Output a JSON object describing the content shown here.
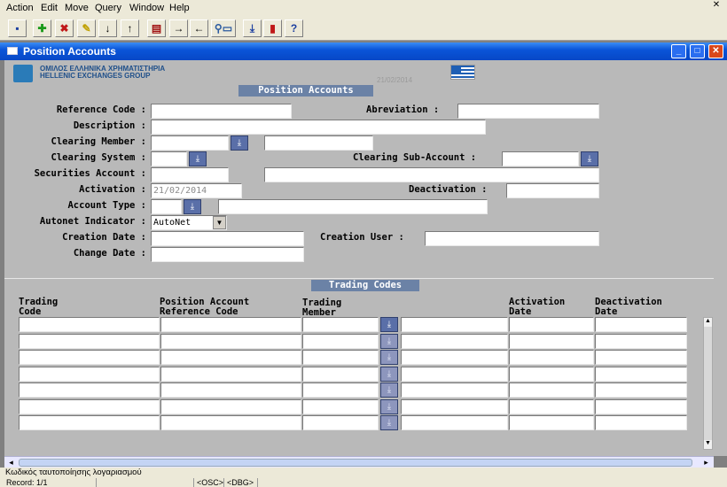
{
  "menu": {
    "items": [
      {
        "label": "Action"
      },
      {
        "label": "Edit"
      },
      {
        "label": "Move"
      },
      {
        "label": "Query"
      },
      {
        "label": "Window"
      },
      {
        "label": "Help"
      }
    ]
  },
  "toolbar": {
    "icons": [
      "save-icon",
      "add-icon",
      "delete-icon",
      "clear-icon",
      "next-icon",
      "previous-icon",
      "print-icon",
      "forward-icon",
      "back-icon",
      "query-icon",
      "download-icon",
      "exit-icon",
      "help-icon"
    ]
  },
  "window": {
    "title": "Position Accounts"
  },
  "header": {
    "logo_greek": "ΟΜΙΛΟΣ ΕΛΛΗΝΙΚΑ ΧΡΗΜΑΤΙΣΤΗΡΙΑ",
    "logo_english": "HELLENIC EXCHANGES GROUP",
    "date_stamp": "21/02/2014"
  },
  "section_main": "Position Accounts",
  "fields": {
    "reference_code": {
      "label": "Reference Code :",
      "value": ""
    },
    "abreviation": {
      "label": "Abreviation :",
      "value": ""
    },
    "description": {
      "label": "Description :",
      "value": ""
    },
    "clearing_member": {
      "label": "Clearing Member :",
      "value": "",
      "desc": ""
    },
    "clearing_system": {
      "label": "Clearing System :",
      "value": ""
    },
    "clearing_sub_account": {
      "label": "Clearing Sub-Account :",
      "value": ""
    },
    "securities_account": {
      "label": "Securities Account :",
      "value": "",
      "desc": ""
    },
    "activation": {
      "label": "Activation :",
      "value": "21/02/2014"
    },
    "deactivation": {
      "label": "Deactivation :",
      "value": ""
    },
    "account_type": {
      "label": "Account Type :",
      "value": "",
      "desc": ""
    },
    "autonet_indicator": {
      "label": "Autonet Indicator :",
      "value": "AutoNet"
    },
    "creation_date": {
      "label": "Creation Date :",
      "value": ""
    },
    "creation_user": {
      "label": "Creation User :",
      "value": ""
    },
    "change_date": {
      "label": "Change Date :",
      "value": ""
    }
  },
  "section_trading": "Trading Codes",
  "trading_table": {
    "columns": [
      "Trading\nCode",
      "Position Account\nReference Code",
      "Trading\nMember",
      "Activation\nDate",
      "Deactivation\nDate"
    ],
    "rows": [
      [
        "",
        "",
        "",
        "",
        "",
        ""
      ],
      [
        "",
        "",
        "",
        "",
        "",
        ""
      ],
      [
        "",
        "",
        "",
        "",
        "",
        ""
      ],
      [
        "",
        "",
        "",
        "",
        "",
        ""
      ],
      [
        "",
        "",
        "",
        "",
        "",
        ""
      ],
      [
        "",
        "",
        "",
        "",
        "",
        ""
      ],
      [
        "",
        "",
        "",
        "",
        "",
        ""
      ]
    ]
  },
  "status": {
    "hint": "Κωδικός ταυτοποίησης λογαριασμού",
    "record": "Record: 1/1",
    "osc": "<OSC>",
    "dbg": "<DBG>"
  },
  "colors": {
    "form_bg": "#b9b9b9",
    "section_bg": "#6b82a6",
    "lov_button": "#5a6fa8",
    "titlebar": "#0a55d9"
  }
}
